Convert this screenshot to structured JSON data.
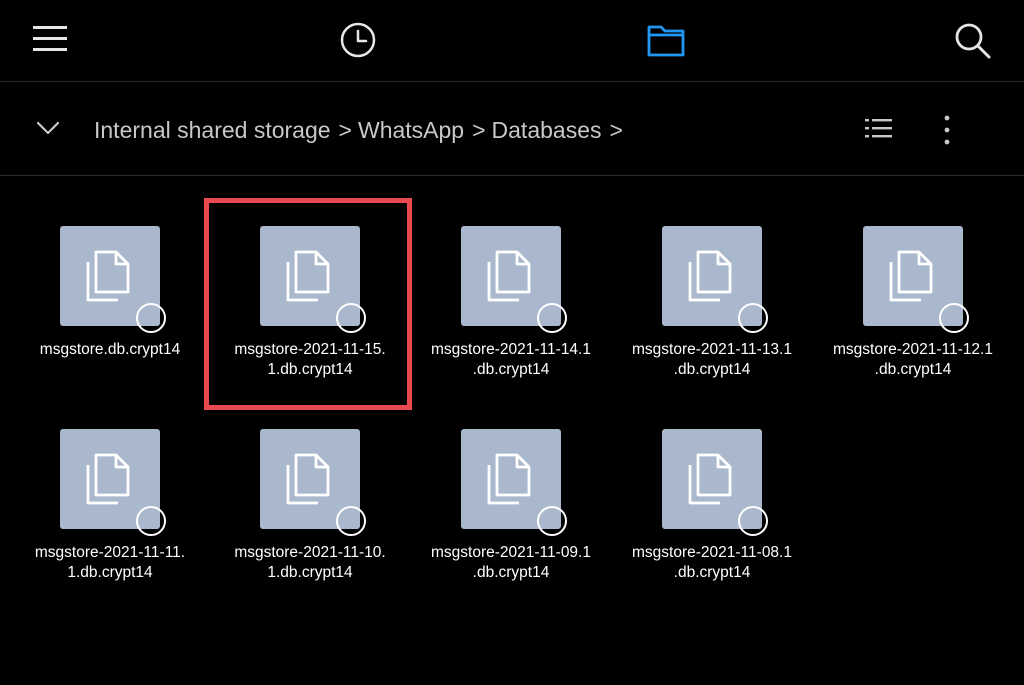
{
  "app": {
    "accent_color": "#2196F3",
    "highlight_color": "#e84a4f"
  },
  "topbar": {
    "icons": [
      "hamburger-menu-icon",
      "recent-clock-icon",
      "folder-icon",
      "search-icon"
    ]
  },
  "breadcrumb": {
    "items": [
      "Internal shared storage",
      "WhatsApp",
      "Databases"
    ],
    "separator": ">"
  },
  "files": [
    {
      "line1": "msgstore.db.crypt14",
      "line2": "",
      "selected": false
    },
    {
      "line1": "msgstore-2021-11-15.",
      "line2": "1.db.crypt14",
      "selected": true
    },
    {
      "line1": "msgstore-2021-11-14.1",
      "line2": ".db.crypt14",
      "selected": false
    },
    {
      "line1": "msgstore-2021-11-13.1",
      "line2": ".db.crypt14",
      "selected": false
    },
    {
      "line1": "msgstore-2021-11-12.1",
      "line2": ".db.crypt14",
      "selected": false
    },
    {
      "line1": "msgstore-2021-11-11.",
      "line2": "1.db.crypt14",
      "selected": false
    },
    {
      "line1": "msgstore-2021-11-10.",
      "line2": "1.db.crypt14",
      "selected": false
    },
    {
      "line1": "msgstore-2021-11-09.1",
      "line2": ".db.crypt14",
      "selected": false
    },
    {
      "line1": "msgstore-2021-11-08.1",
      "line2": ".db.crypt14",
      "selected": false
    }
  ]
}
